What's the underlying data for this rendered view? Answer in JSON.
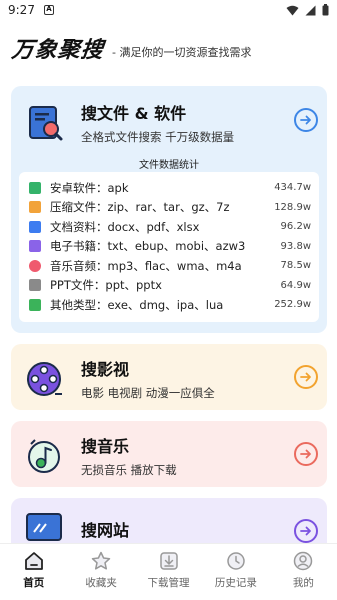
{
  "status_bar": {
    "time": "9:27",
    "notification": "A"
  },
  "header": {
    "logo": "万象聚搜",
    "slogan": "- 满足你的一切资源查找需求"
  },
  "files_card": {
    "title": "搜文件 & 软件",
    "subtitle": "全格式文件搜索 千万级数据量",
    "stats_title": "文件数据统计",
    "rows": [
      {
        "name": "安卓软件：apk",
        "count": "434.7w",
        "icon": "android-icon",
        "color": "#34b36a"
      },
      {
        "name": "压缩文件：zip、rar、tar、gz、7z",
        "count": "128.9w",
        "icon": "archive-icon",
        "color": "#f2a33a"
      },
      {
        "name": "文档资料：docx、pdf、xlsx",
        "count": "96.2w",
        "icon": "word-doc-icon",
        "color": "#3d7cf0"
      },
      {
        "name": "电子书籍：txt、ebup、mobi、azw3",
        "count": "93.8w",
        "icon": "book-icon",
        "color": "#8a63e8"
      },
      {
        "name": "音乐音频：mp3、flac、wma、m4a",
        "count": "78.5w",
        "icon": "music-file-icon",
        "color": "#ef5a6e"
      },
      {
        "name": "PPT文件：ppt、pptx",
        "count": "64.9w",
        "icon": "ppt-icon",
        "color": "#8a8a8a"
      },
      {
        "name": "其他类型：exe、dmg、ipa、lua",
        "count": "252.9w",
        "icon": "other-file-icon",
        "color": "#3bb35a"
      }
    ]
  },
  "video_card": {
    "title": "搜影视",
    "subtitle": "电影 电视剧 动漫一应俱全"
  },
  "music_card": {
    "title": "搜音乐",
    "subtitle": "无损音乐 播放下载"
  },
  "web_card": {
    "title": "搜网站"
  },
  "nav": [
    {
      "label": "首页",
      "icon": "home-icon"
    },
    {
      "label": "收藏夹",
      "icon": "star-icon"
    },
    {
      "label": "下载管理",
      "icon": "download-icon"
    },
    {
      "label": "历史记录",
      "icon": "history-icon"
    },
    {
      "label": "我的",
      "icon": "profile-icon"
    }
  ],
  "colors": {
    "blue": "#3d86e6",
    "orange": "#f2a32f",
    "red": "#ea6a5e",
    "purple": "#7a52e0"
  }
}
